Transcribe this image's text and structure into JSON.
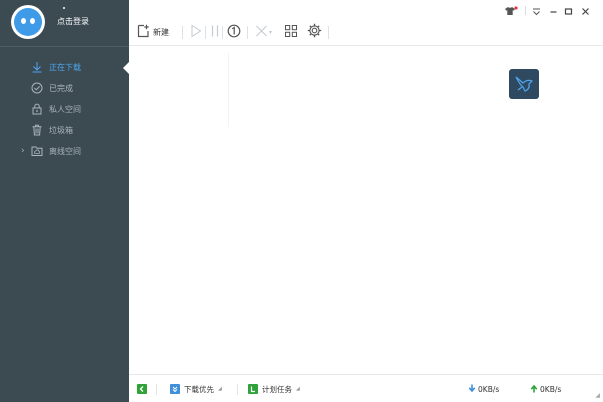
{
  "user": {
    "login_label": "点击登录"
  },
  "sidebar": {
    "items": [
      {
        "label": "正在下载",
        "icon": "download-arrow-icon",
        "active": true
      },
      {
        "label": "已完成",
        "icon": "check-circle-icon",
        "active": false
      },
      {
        "label": "私人空间",
        "icon": "lock-icon",
        "active": false
      },
      {
        "label": "垃圾箱",
        "icon": "trash-icon",
        "active": false
      },
      {
        "label": "离线空间",
        "icon": "cloud-folder-icon",
        "active": false
      }
    ]
  },
  "toolbar": {
    "new_label": "新建"
  },
  "statusbar": {
    "download_priority": "下载优先",
    "scheduled_task": "计划任务",
    "download_speed": "0KB/s",
    "upload_speed": "0KB/s"
  },
  "colors": {
    "sidebar_bg": "#3c4a52",
    "accent_blue": "#4ea7f0",
    "green": "#2fa33a"
  }
}
